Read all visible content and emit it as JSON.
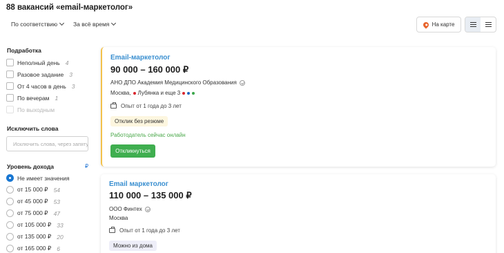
{
  "header": {
    "title": "88 вакансий «email-маркетолог»"
  },
  "toolbar": {
    "sort_label": "По соответствию",
    "period_label": "За всё время",
    "map_label": "На карте"
  },
  "sidebar": {
    "employment_items": [
      {
        "label": "Неполный день",
        "count": "4"
      },
      {
        "label": "Разовое задание",
        "count": "3"
      },
      {
        "label": "От 4 часов в день",
        "count": "3"
      },
      {
        "label": "По вечерам",
        "count": "1"
      },
      {
        "label": "По выходным",
        "count": ""
      }
    ],
    "employment_heading": "Подработка",
    "exclude_heading": "Исключить слова",
    "exclude_placeholder": "Исключить слова, через запятую",
    "income_heading": "Уровень дохода",
    "income_currency_link": "₽",
    "income_options": [
      {
        "label": "Не имеет значения",
        "count": "",
        "checked": true
      },
      {
        "label": "от 15 000 ₽",
        "count": "54",
        "checked": false
      },
      {
        "label": "от 45 000 ₽",
        "count": "53",
        "checked": false
      },
      {
        "label": "от 75 000 ₽",
        "count": "47",
        "checked": false
      },
      {
        "label": "от 105 000 ₽",
        "count": "33",
        "checked": false
      },
      {
        "label": "от 135 000 ₽",
        "count": "20",
        "checked": false
      },
      {
        "label": "от 165 000 ₽",
        "count": "6",
        "checked": false
      }
    ]
  },
  "vacancies": [
    {
      "title": "Email-маркетолог",
      "salary": "90 000 – 160 000 ₽",
      "company": "АНО ДПО Академия Медицинского Образования",
      "location": "Москва,",
      "metro": "Лубянка и еще 3",
      "metro_colors": [
        "#d9262e",
        "#d9262e",
        "#1f67c2",
        "#3aa64a"
      ],
      "experience": "Опыт от 1 года до 3 лет",
      "badge": "Отклик без резюме",
      "online": "Работодатель сейчас онлайн",
      "apply_label": "Откликнуться"
    },
    {
      "title": "Email маркетолог",
      "salary": "110 000 – 135 000 ₽",
      "company": "ООО Финтех",
      "location": "Москва",
      "experience": "Опыт от 1 года до 3 лет",
      "badge": "Можно из дома"
    }
  ]
}
